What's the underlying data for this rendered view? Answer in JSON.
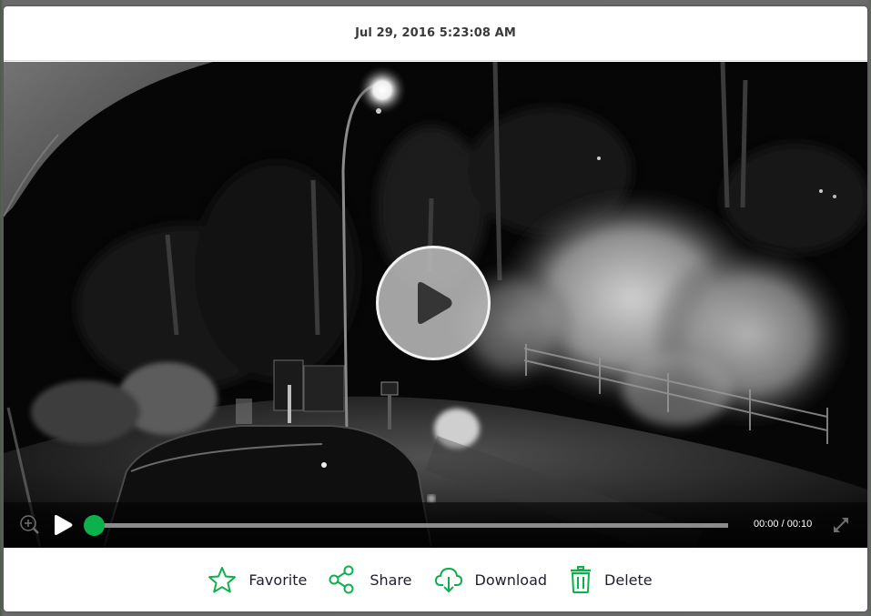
{
  "modal": {
    "title": "Jul 29, 2016 5:23:08 AM"
  },
  "player": {
    "state": "paused",
    "current_time": "00:00",
    "duration": "00:10",
    "time_display": "00:00 / 00:10",
    "progress_fraction": 0.0,
    "accent_color": "#0db14b",
    "controls": {
      "zoom_icon": "zoom-in-icon",
      "play_icon": "play-icon",
      "fullscreen_icon": "fullscreen-icon"
    },
    "big_play_icon": "play-icon",
    "scene_description": "Night-vision security camera view of a driveway with a street lamp, trees, mailbox, fence and a parked vehicle"
  },
  "actions": [
    {
      "id": "favorite",
      "label": "Favorite",
      "icon": "star-icon"
    },
    {
      "id": "share",
      "label": "Share",
      "icon": "share-icon"
    },
    {
      "id": "download",
      "label": "Download",
      "icon": "cloud-download-icon"
    },
    {
      "id": "delete",
      "label": "Delete",
      "icon": "trash-icon"
    }
  ],
  "colors": {
    "accent": "#0db14b",
    "title_text": "#3a3a3a",
    "action_text": "#1f1f2e"
  }
}
